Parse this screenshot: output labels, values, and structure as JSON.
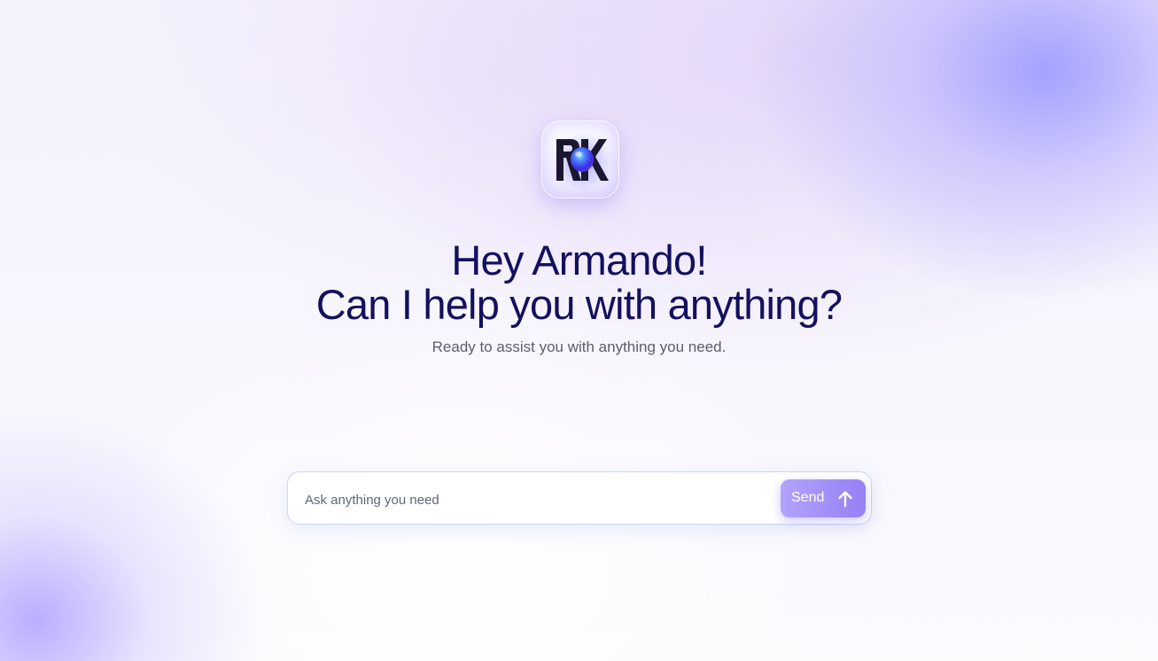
{
  "logo": {
    "icon": "rk-logo-icon"
  },
  "greeting": {
    "line1": "Hey Armando!",
    "line2": "Can I help you with anything?",
    "subtitle": "Ready to assist you with anything you need."
  },
  "composer": {
    "placeholder": "Ask anything you need",
    "value": "",
    "send_label": "Send",
    "send_icon": "arrow-up-icon"
  },
  "colors": {
    "heading": "#14105e",
    "accent": "#9680f5",
    "accent_light": "#b3a3fb"
  }
}
